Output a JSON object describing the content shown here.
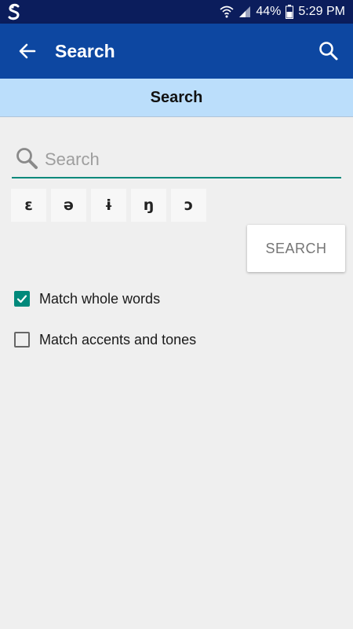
{
  "status_bar": {
    "battery": "44%",
    "time": "5:29 PM",
    "icons": [
      "app-logo-icon",
      "wifi-icon",
      "signal-icon",
      "battery-icon"
    ]
  },
  "app_bar": {
    "title": "Search",
    "back_icon": "arrow-left-icon",
    "action_icon": "search-icon"
  },
  "sub_header": {
    "title": "Search"
  },
  "search": {
    "placeholder": "Search",
    "value": ""
  },
  "special_chars": [
    "ɛ",
    "ə",
    "ɨ",
    "ŋ",
    "ɔ"
  ],
  "search_button": {
    "label": "SEARCH"
  },
  "options": [
    {
      "label": "Match whole words",
      "checked": true
    },
    {
      "label": "Match accents and tones",
      "checked": false
    }
  ],
  "colors": {
    "status_bar": "#0b1d5c",
    "app_bar": "#0d47a1",
    "sub_header": "#bbdefb",
    "accent": "#00897b",
    "background": "#efefef"
  }
}
